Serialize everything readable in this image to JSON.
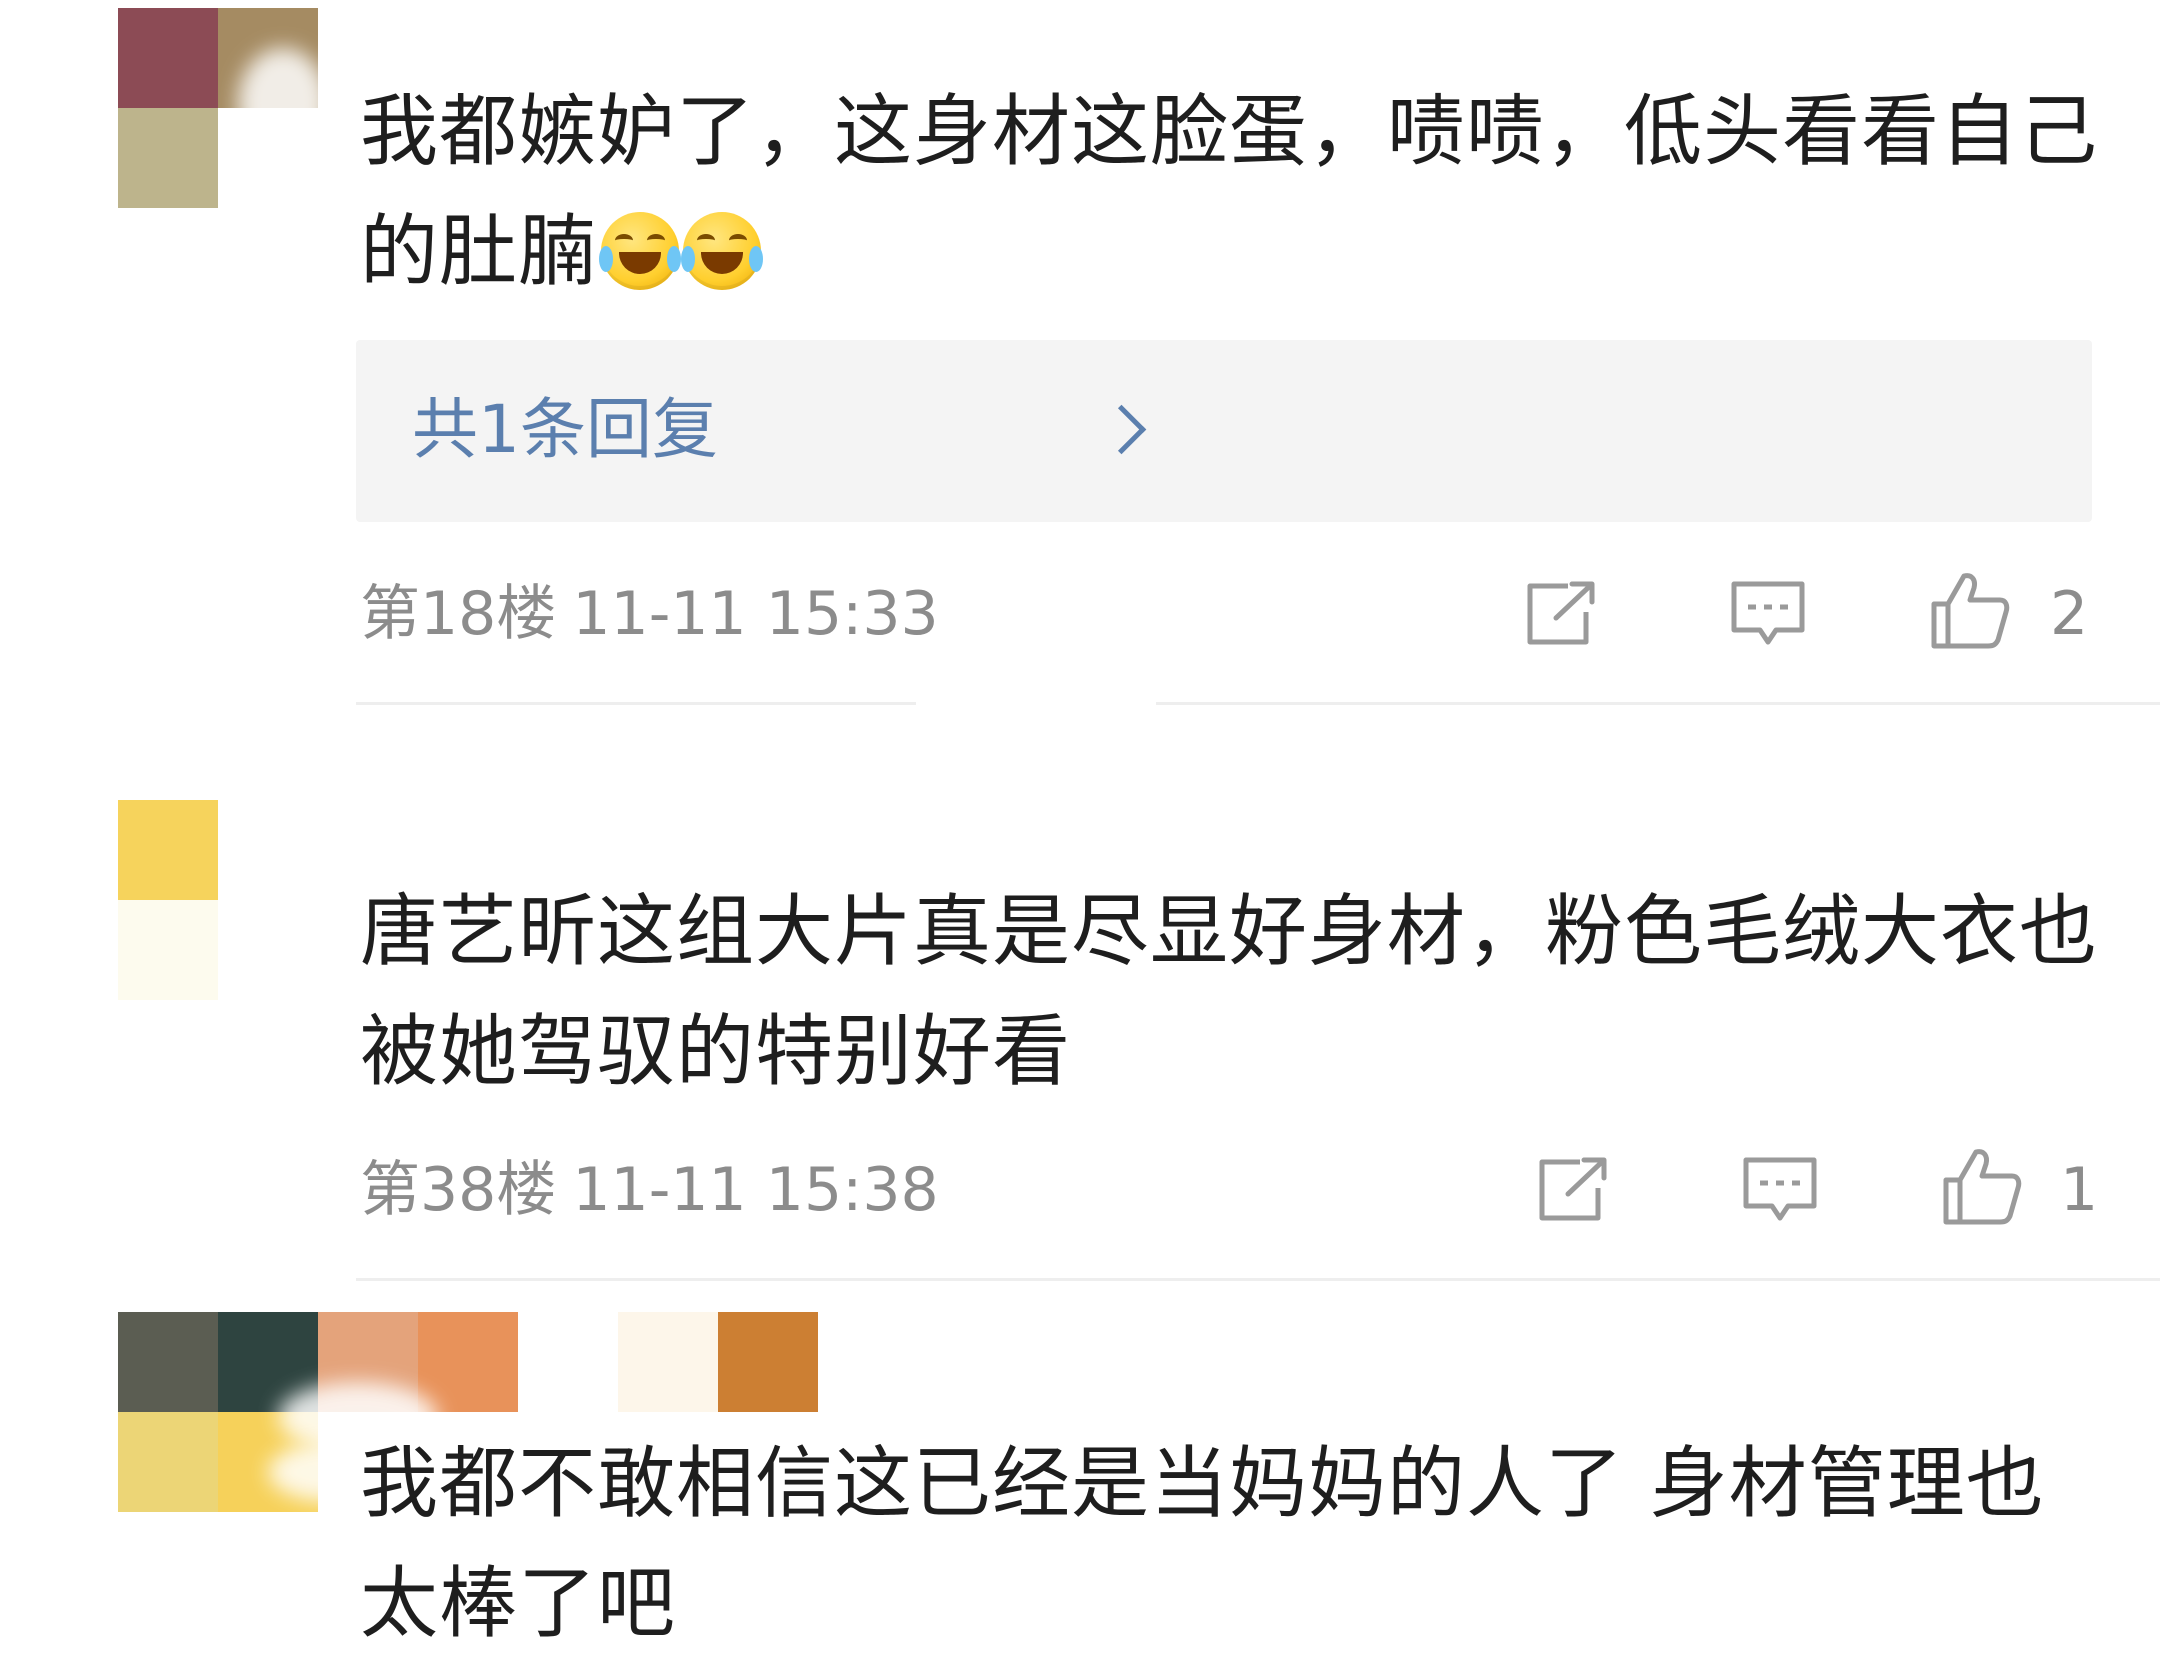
{
  "comments": [
    {
      "text": "我都嫉妒了，这身材这脸蛋，啧啧，低头看看自己的肚腩",
      "emojis": [
        "laugh-cry-emoji",
        "laugh-cry-emoji"
      ],
      "reply_summary": "共1条回复",
      "floor": "第18楼",
      "time": "11-11 15:33",
      "likes": "2"
    },
    {
      "text": "唐艺昕这组大片真是尽显好身材，粉色毛绒大衣也被她驾驭的特别好看",
      "floor": "第38楼",
      "time": "11-11 15:38",
      "likes": "1"
    },
    {
      "text": "我都不敢相信这已经是当妈妈的人了 身材管理也太棒了吧"
    }
  ],
  "icons": {
    "share": "share-icon",
    "comment": "comment-icon",
    "like": "thumbs-up-icon",
    "reply_arrow": "chevron-right-icon"
  },
  "colors": {
    "reply_link": "#5b7fae",
    "meta_text": "#8c8c8c",
    "reply_box_bg": "#f4f4f4",
    "icon_stroke": "#9a9a9a"
  }
}
